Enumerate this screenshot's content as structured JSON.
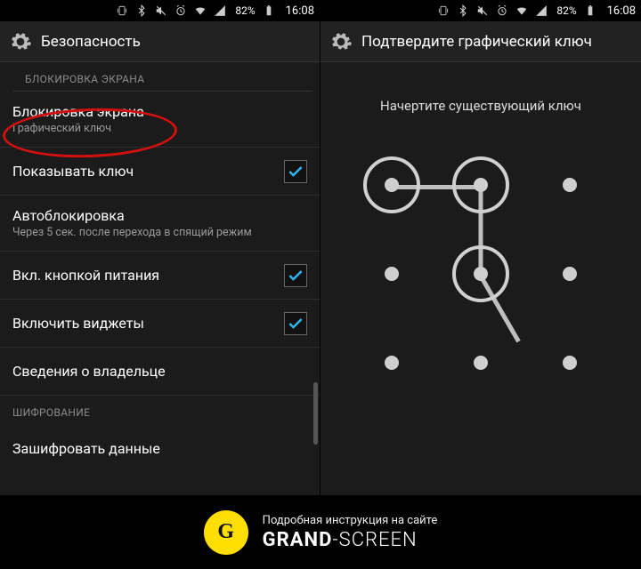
{
  "status": {
    "battery_pct": "82%",
    "time": "16:08"
  },
  "left": {
    "title": "Безопасность",
    "section_lock": "БЛОКИРОВКА ЭКРАНА",
    "items": {
      "screen_lock": {
        "label": "Блокировка экрана",
        "sub": "Графический ключ"
      },
      "show_pattern": {
        "label": "Показывать ключ"
      },
      "auto_lock": {
        "label": "Автоблокировка",
        "sub": "Через 5 сек. после перехода в спящий режим"
      },
      "power_lock": {
        "label": "Вкл. кнопкой питания"
      },
      "widgets": {
        "label": "Включить виджеты"
      },
      "owner_info": {
        "label": "Сведения о владельце"
      }
    },
    "section_enc": "ШИФРОВАНИЕ",
    "encrypt": {
      "label": "Зашифровать данные"
    }
  },
  "right": {
    "title": "Подтвердите графический ключ",
    "prompt": "Начертите существующий ключ"
  },
  "banner": {
    "tagline": "Подробная инструкция на сайте",
    "brand_bold": "GRAND",
    "brand_thin": "-SCREEN",
    "logo_letter": "G"
  }
}
